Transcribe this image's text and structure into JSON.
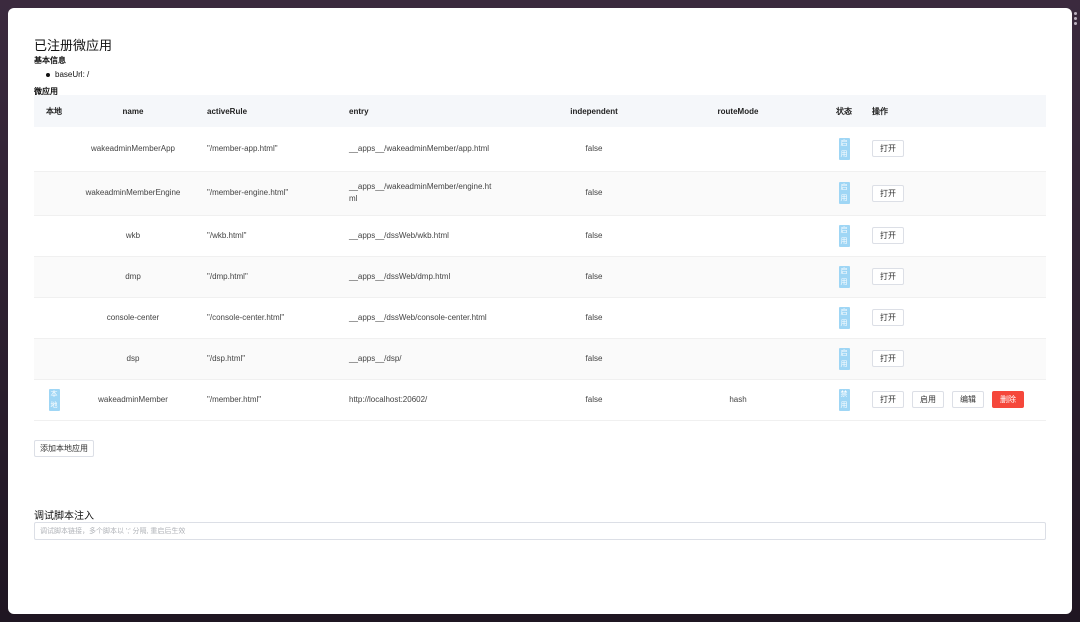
{
  "title": "已注册微应用",
  "basic_info": {
    "heading": "基本信息",
    "base_url": "baseUrl: /"
  },
  "micro_apps": {
    "heading": "微应用",
    "columns": {
      "local": "本地",
      "name": "name",
      "activeRule": "activeRule",
      "entry": "entry",
      "independent": "independent",
      "routeMode": "routeMode",
      "status": "状态",
      "ops": "操作"
    },
    "rows": [
      {
        "local": "",
        "name": "wakeadminMemberApp",
        "activeRule": "\"/member-app.html\"",
        "entry": "__apps__/wakeadminMember/app.html",
        "independent": "false",
        "routeMode": "",
        "status": "启用",
        "open": "打开"
      },
      {
        "local": "",
        "name": "wakeadminMemberEngine",
        "activeRule": "\"/member-engine.html\"",
        "entry": "__apps__/wakeadminMember/engine.html",
        "independent": "false",
        "routeMode": "",
        "status": "启用",
        "open": "打开"
      },
      {
        "local": "",
        "name": "wkb",
        "activeRule": "\"/wkb.html\"",
        "entry": "__apps__/dssWeb/wkb.html",
        "independent": "false",
        "routeMode": "",
        "status": "启用",
        "open": "打开"
      },
      {
        "local": "",
        "name": "dmp",
        "activeRule": "\"/dmp.html\"",
        "entry": "__apps__/dssWeb/dmp.html",
        "independent": "false",
        "routeMode": "",
        "status": "启用",
        "open": "打开"
      },
      {
        "local": "",
        "name": "console-center",
        "activeRule": "\"/console-center.html\"",
        "entry": "__apps__/dssWeb/console-center.html",
        "independent": "false",
        "routeMode": "",
        "status": "启用",
        "open": "打开"
      },
      {
        "local": "",
        "name": "dsp",
        "activeRule": "\"/dsp.html\"",
        "entry": "__apps__/dsp/",
        "independent": "false",
        "routeMode": "",
        "status": "启用",
        "open": "打开"
      },
      {
        "local": "本地",
        "name": "wakeadminMember",
        "activeRule": "\"/member.html\"",
        "entry": "http://localhost:20602/",
        "independent": "false",
        "routeMode": "hash",
        "status": "禁用",
        "open": "打开",
        "enable": "启用",
        "edit": "编辑",
        "delete": "删除"
      }
    ],
    "add_button": "添加本地应用"
  },
  "debug": {
    "heading": "调试脚本注入",
    "placeholder": "调试脚本链接，多个脚本以 ';' 分隔, 重启后生效"
  },
  "colors": {
    "tag_bg": "#9fd6f5",
    "danger": "#f5473b",
    "header_bg": "#f5f7fa"
  }
}
